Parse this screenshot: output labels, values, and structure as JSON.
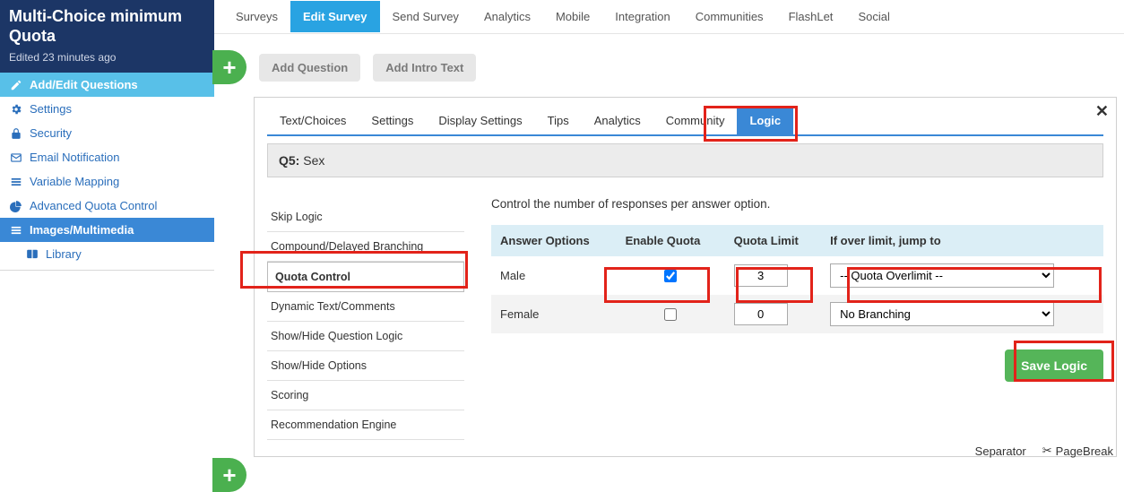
{
  "sidebar": {
    "title": "Multi-Choice minimum Quota",
    "edited": "Edited 23 minutes ago",
    "items": [
      {
        "label": "Add/Edit Questions",
        "icon": "pencil",
        "active": "light"
      },
      {
        "label": "Settings",
        "icon": "gears"
      },
      {
        "label": "Security",
        "icon": "lock"
      },
      {
        "label": "Email Notification",
        "icon": "envelope"
      },
      {
        "label": "Variable Mapping",
        "icon": "list"
      },
      {
        "label": "Advanced Quota Control",
        "icon": "pie"
      },
      {
        "label": "Images/Multimedia",
        "icon": "bars",
        "active": "dark"
      },
      {
        "label": "Library",
        "icon": "book",
        "sub": true
      }
    ]
  },
  "toptabs": [
    "Surveys",
    "Edit Survey",
    "Send Survey",
    "Analytics",
    "Mobile",
    "Integration",
    "Communities",
    "FlashLet",
    "Social"
  ],
  "toptab_active": "Edit Survey",
  "addbar": {
    "add_question": "Add Question",
    "add_intro": "Add Intro Text"
  },
  "qtabs": [
    "Text/Choices",
    "Settings",
    "Display Settings",
    "Tips",
    "Analytics",
    "Community",
    "Logic"
  ],
  "qtab_active": "Logic",
  "question": {
    "code": "Q5:",
    "title": "Sex"
  },
  "logic_sidebar": [
    "Skip Logic",
    "Compound/Delayed Branching",
    "Quota Control",
    "Dynamic Text/Comments",
    "Show/Hide Question Logic",
    "Show/Hide Options",
    "Scoring",
    "Recommendation Engine"
  ],
  "logic_selected": "Quota Control",
  "logic_main": {
    "desc": "Control the number of responses per answer option.",
    "headers": [
      "Answer Options",
      "Enable Quota",
      "Quota Limit",
      "If over limit, jump to"
    ],
    "rows": [
      {
        "option": "Male",
        "enabled": true,
        "limit": "3",
        "jump": "-- Quota Overlimit --"
      },
      {
        "option": "Female",
        "enabled": false,
        "limit": "0",
        "jump": "No Branching"
      }
    ],
    "save": "Save Logic"
  },
  "footer": {
    "separator": "Separator",
    "pagebreak": "PageBreak"
  }
}
